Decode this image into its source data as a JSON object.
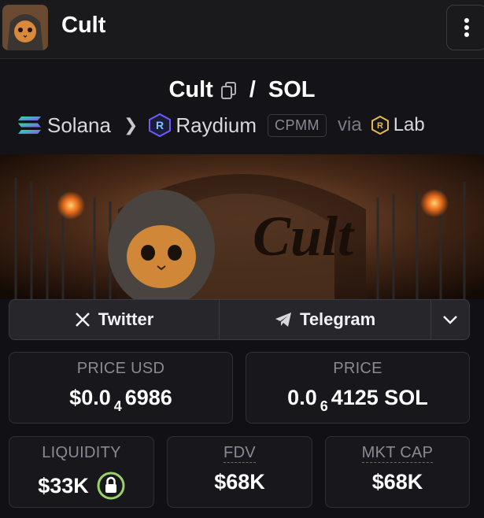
{
  "topbar": {
    "title": "Cult",
    "avatar_icon": "hooded-cat-avatar",
    "menu_icon": "kebab-menu-icon"
  },
  "pair": {
    "base": "Cult",
    "sep": "/",
    "quote": "SOL"
  },
  "chain": {
    "network": "Solana",
    "dex": "Raydium",
    "pool_type": "CPMM",
    "via": "via",
    "launchpad": "Lab"
  },
  "banner": {
    "text": "Cult"
  },
  "social": {
    "twitter": "Twitter",
    "telegram": "Telegram"
  },
  "stats": {
    "price_usd": {
      "label": "PRICE USD",
      "prefix": "$0.0",
      "zeros": "4",
      "digits": "6986"
    },
    "price": {
      "label": "PRICE",
      "prefix": "0.0",
      "zeros": "6",
      "digits": "4125 SOL"
    },
    "liquidity": {
      "label": "LIQUIDITY",
      "value": "$33K"
    },
    "fdv": {
      "label": "FDV",
      "value": "$68K"
    },
    "mkt_cap": {
      "label": "MKT CAP",
      "value": "$68K"
    }
  },
  "colors": {
    "background": "#111115",
    "lock_ring": "#9bd16a",
    "solana_gradient": [
      "#9945ff",
      "#14f195"
    ],
    "raydium": "#5a6cff",
    "lab": "#e8b84a"
  }
}
